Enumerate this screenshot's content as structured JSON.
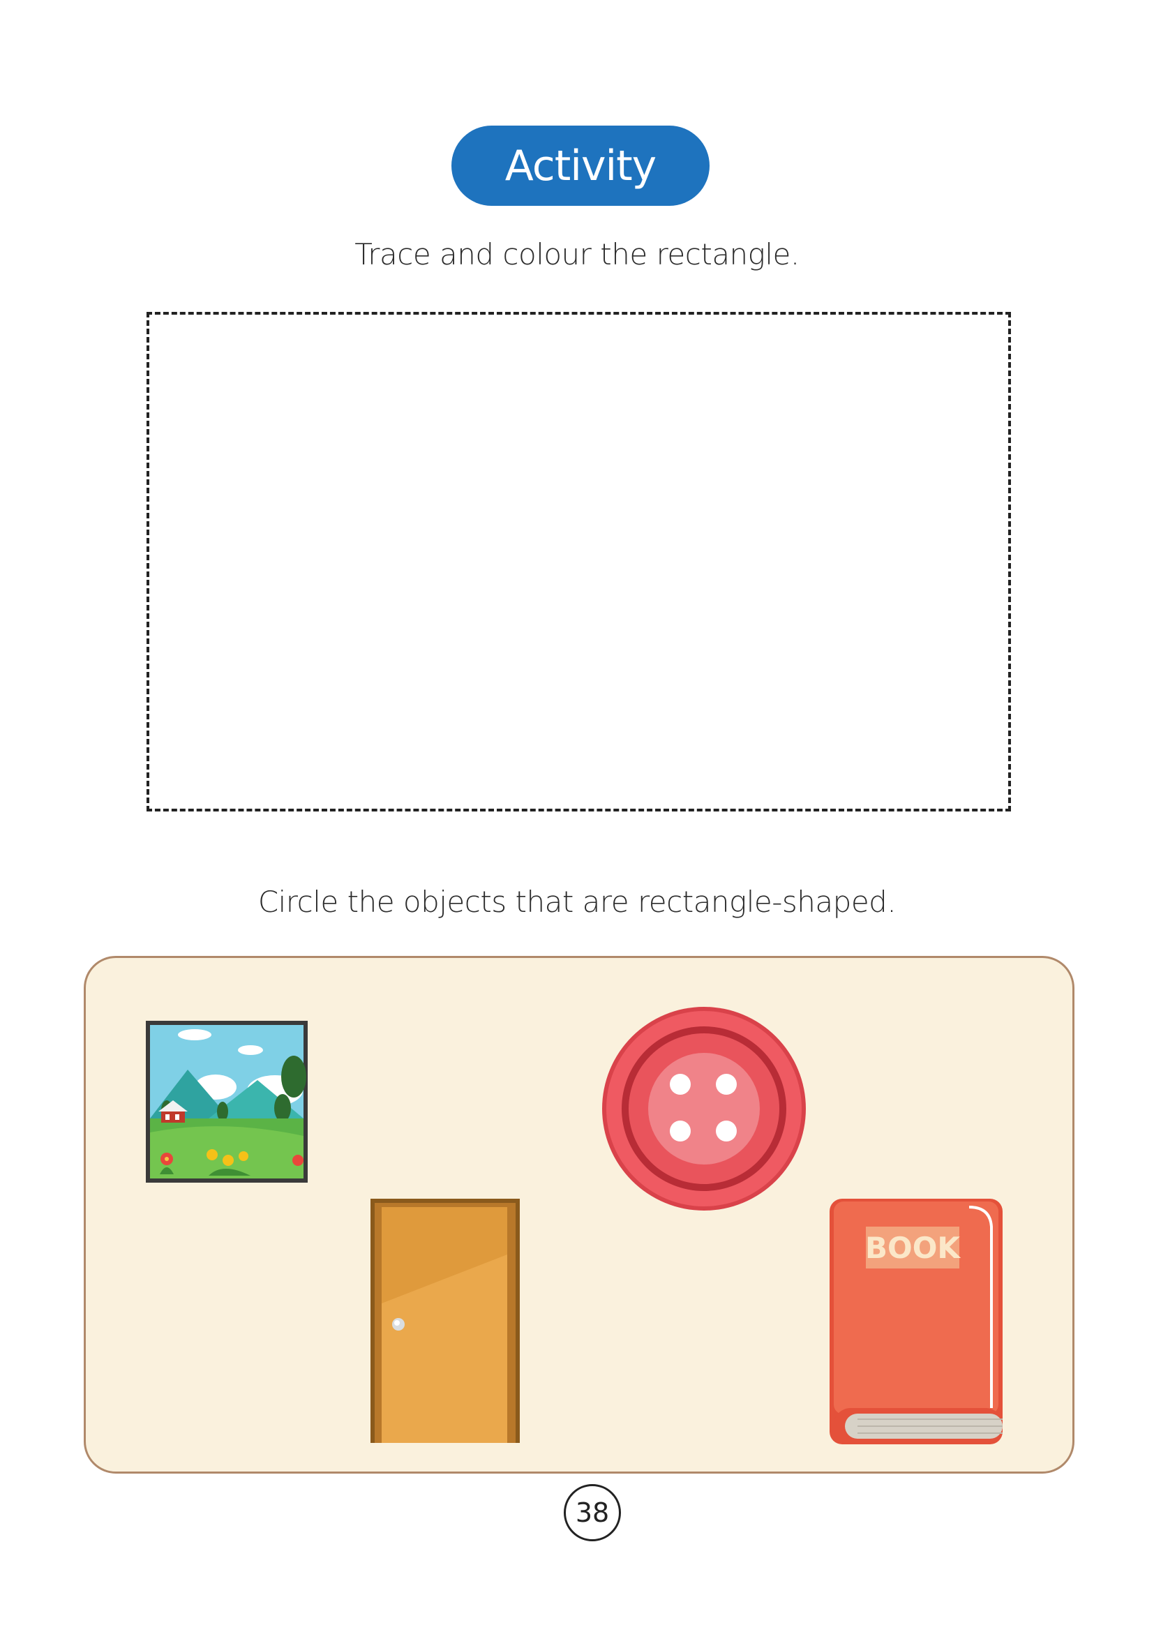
{
  "header": {
    "activity_label": "Activity"
  },
  "tracing": {
    "instruction": "Trace and colour the rectangle."
  },
  "circling": {
    "instruction": "Circle the objects that are rectangle-shaped.",
    "objects": [
      {
        "name": "picture-frame",
        "icon": "landscape-picture-icon"
      },
      {
        "name": "button",
        "icon": "round-button-icon"
      },
      {
        "name": "door",
        "icon": "door-icon"
      },
      {
        "name": "book",
        "icon": "book-icon",
        "label": "BOOK"
      }
    ]
  },
  "footer": {
    "page_number": "38"
  },
  "colors": {
    "accent_blue": "#1e73be",
    "panel_bg": "#faf1dd",
    "panel_border": "#b0896a"
  }
}
